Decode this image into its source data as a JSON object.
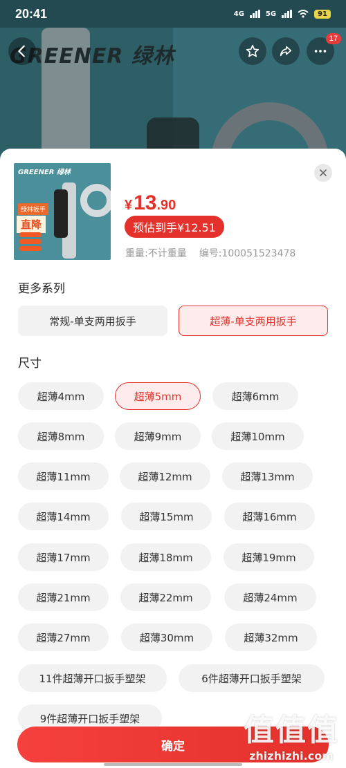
{
  "status_bar": {
    "time": "20:41",
    "network_1": "4G",
    "network_2": "5G",
    "battery": "91"
  },
  "header": {
    "brand_logo": "GREENER 绿林",
    "back_icon": "chevron-left-icon",
    "favorite_icon": "star-icon",
    "share_icon": "share-icon",
    "more_icon": "more-dots-icon",
    "more_badge": "17"
  },
  "product": {
    "thumb": {
      "logo": "GREENER 绿林",
      "tag": "绿林扳手",
      "headline": "直降",
      "side_text": "1把顶2把"
    },
    "price_currency": "¥",
    "price_integer": "13",
    "price_decimal": ".90",
    "estimated_price": "预估到手¥12.51",
    "weight": "重量:不计重量",
    "sku_number": "编号:100051523478"
  },
  "series": {
    "title": "更多系列",
    "options": [
      {
        "label": "常规-单支两用扳手",
        "selected": false
      },
      {
        "label": "超薄-单支两用扳手",
        "selected": true
      }
    ]
  },
  "size": {
    "title": "尺寸",
    "options": [
      {
        "label": "超薄4mm",
        "selected": false
      },
      {
        "label": "超薄5mm",
        "selected": true
      },
      {
        "label": "超薄6mm",
        "selected": false
      },
      {
        "label": "超薄8mm",
        "selected": false
      },
      {
        "label": "超薄9mm",
        "selected": false
      },
      {
        "label": "超薄10mm",
        "selected": false
      },
      {
        "label": "超薄11mm",
        "selected": false
      },
      {
        "label": "超薄12mm",
        "selected": false
      },
      {
        "label": "超薄13mm",
        "selected": false
      },
      {
        "label": "超薄14mm",
        "selected": false
      },
      {
        "label": "超薄15mm",
        "selected": false
      },
      {
        "label": "超薄16mm",
        "selected": false
      },
      {
        "label": "超薄17mm",
        "selected": false
      },
      {
        "label": "超薄18mm",
        "selected": false
      },
      {
        "label": "超薄19mm",
        "selected": false
      },
      {
        "label": "超薄21mm",
        "selected": false
      },
      {
        "label": "超薄22mm",
        "selected": false
      },
      {
        "label": "超薄24mm",
        "selected": false
      },
      {
        "label": "超薄27mm",
        "selected": false
      },
      {
        "label": "超薄30mm",
        "selected": false
      },
      {
        "label": "超薄32mm",
        "selected": false
      },
      {
        "label": "11件超薄开口扳手塑架",
        "selected": false
      },
      {
        "label": "6件超薄开口扳手塑架",
        "selected": false
      },
      {
        "label": "9件超薄开口扳手塑架",
        "selected": false
      }
    ]
  },
  "confirm_label": "确定",
  "watermark": {
    "mark": "值值值",
    "url": "zhizhizhi.com"
  },
  "colors": {
    "accent": "#e4312b",
    "accent_light": "#fdeceb",
    "chip_bg": "#f2f2f2"
  }
}
